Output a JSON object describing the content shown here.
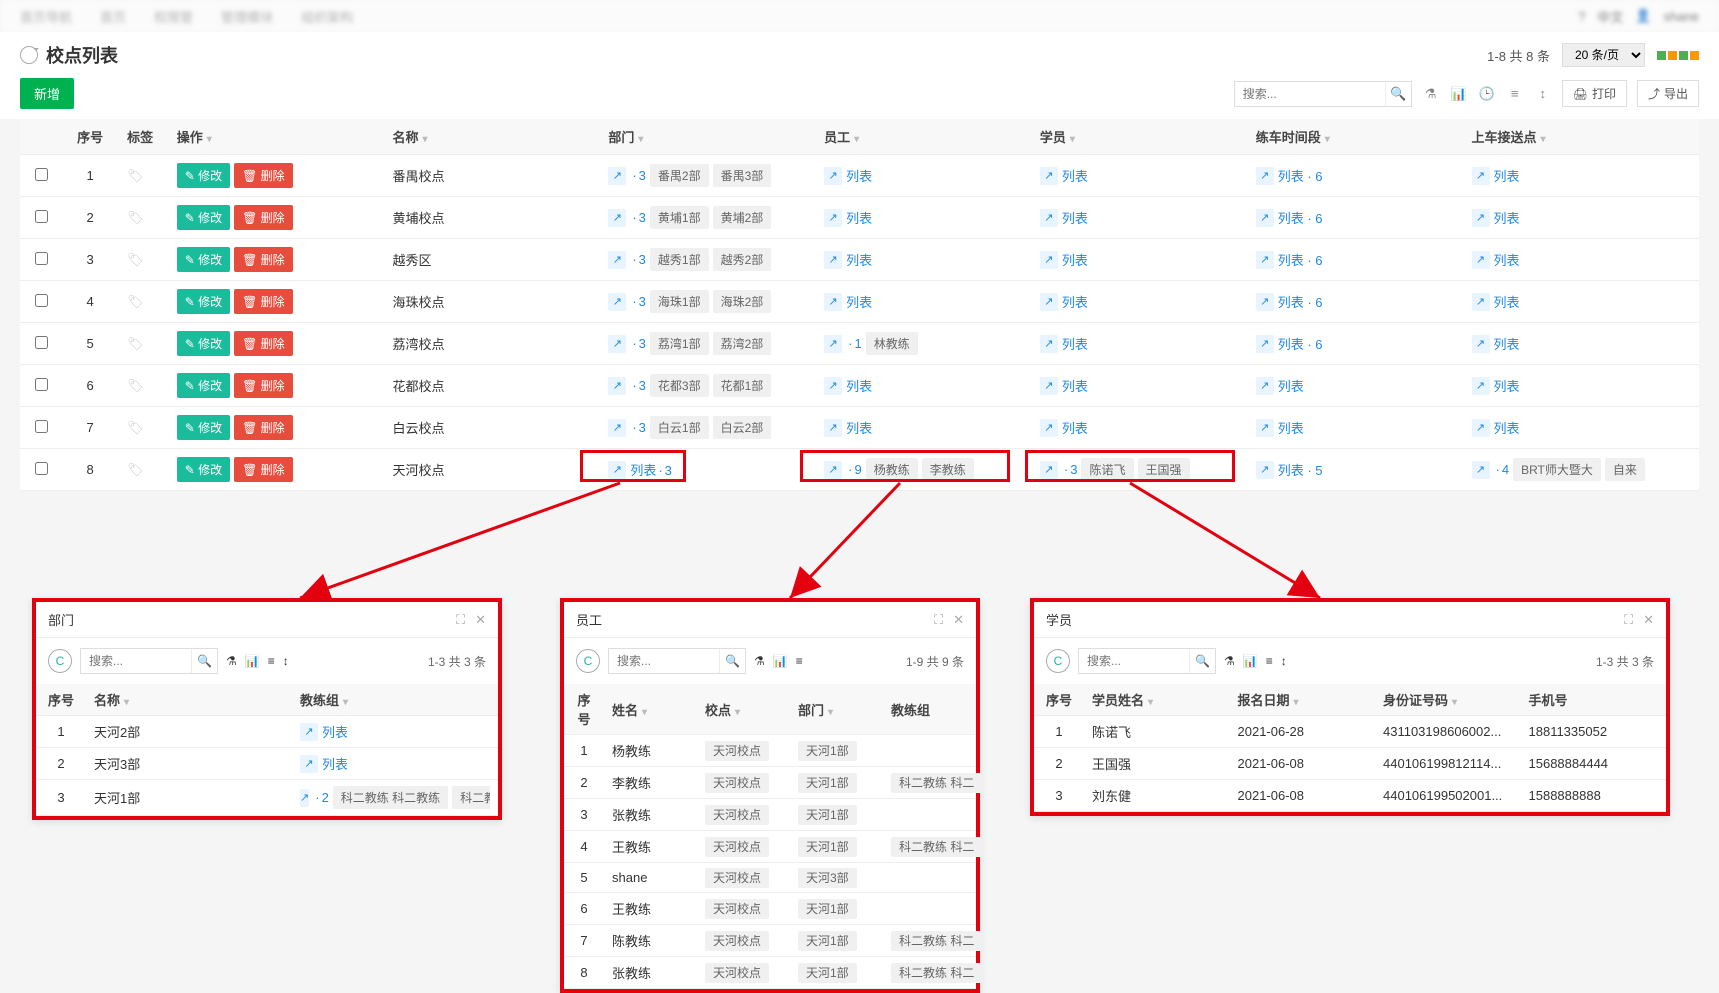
{
  "topnav": {
    "tabs": [
      "首页导航",
      "首页",
      "权限管",
      "管理模块",
      "组织架构"
    ],
    "lang": "中文",
    "user": "shane"
  },
  "page": {
    "title": "校点列表",
    "range": "1-8 共 8 条",
    "pageSize": "20 条/页",
    "search_ph": "搜索..."
  },
  "toolbar": {
    "add": "新增",
    "print_lbl": "打印",
    "export_lbl": "导出"
  },
  "columns": {
    "seq": "序号",
    "tag": "标签",
    "ops": "操作",
    "name": "名称",
    "dept": "部门",
    "emp": "员工",
    "stu": "学员",
    "time": "练车时间段",
    "pick": "上车接送点"
  },
  "ops": {
    "edit": "修改",
    "del": "删除",
    "list": "列表"
  },
  "rows": [
    {
      "seq": 1,
      "name": "番禺校点",
      "dept_n": 3,
      "dept_tags": [
        "番禺2部",
        "番禺3部"
      ],
      "emp": "list",
      "stu": "list",
      "time": "列表 · 6",
      "pick": "list"
    },
    {
      "seq": 2,
      "name": "黄埔校点",
      "dept_n": 3,
      "dept_tags": [
        "黄埔1部",
        "黄埔2部"
      ],
      "emp": "list",
      "stu": "list",
      "time": "列表 · 6",
      "pick": "list"
    },
    {
      "seq": 3,
      "name": "越秀区",
      "dept_n": 3,
      "dept_tags": [
        "越秀1部",
        "越秀2部"
      ],
      "emp": "list",
      "stu": "list",
      "time": "列表 · 6",
      "pick": "list"
    },
    {
      "seq": 4,
      "name": "海珠校点",
      "dept_n": 3,
      "dept_tags": [
        "海珠1部",
        "海珠2部"
      ],
      "emp": "list",
      "stu": "list",
      "time": "列表 · 6",
      "pick": "list"
    },
    {
      "seq": 5,
      "name": "荔湾校点",
      "dept_n": 3,
      "dept_tags": [
        "荔湾1部",
        "荔湾2部"
      ],
      "emp_n": 1,
      "emp_tags": [
        "林教练"
      ],
      "stu": "list",
      "time": "列表 · 6",
      "pick": "list"
    },
    {
      "seq": 6,
      "name": "花都校点",
      "dept_n": 3,
      "dept_tags": [
        "花都3部",
        "花都1部"
      ],
      "emp": "list",
      "stu": "list",
      "time": "list",
      "pick": "list"
    },
    {
      "seq": 7,
      "name": "白云校点",
      "dept_n": 3,
      "dept_tags": [
        "白云1部",
        "白云2部"
      ],
      "emp": "list",
      "stu": "list",
      "time": "list",
      "pick": "list"
    },
    {
      "seq": 8,
      "name": "天河校点",
      "dept_mode": "listnum",
      "dept_n": 3,
      "emp_n": 9,
      "emp_tags": [
        "杨教练",
        "李教练"
      ],
      "stu_n": 3,
      "stu_tags": [
        "陈诺飞",
        "王国强"
      ],
      "time": "列表 · 5",
      "pick_n": 4,
      "pick_tags": [
        "BRT师大暨大",
        "自来"
      ]
    }
  ],
  "popup_dept": {
    "title": "部门",
    "range": "1-3 共 3 条",
    "search_ph": "搜索...",
    "cols": [
      "序号",
      "名称",
      "教练组"
    ],
    "rows": [
      {
        "seq": 1,
        "name": "天河2部",
        "grp": "list"
      },
      {
        "seq": 2,
        "name": "天河3部",
        "grp": "list"
      },
      {
        "seq": 3,
        "name": "天河1部",
        "grp_n": 2,
        "grp_tags": [
          "科二教练 科二教练",
          "科二教练"
        ]
      }
    ]
  },
  "popup_emp": {
    "title": "员工",
    "range": "1-9 共 9 条",
    "search_ph": "搜索...",
    "cols": [
      "序号",
      "姓名",
      "校点",
      "部门",
      "教练组"
    ],
    "rows": [
      {
        "seq": 1,
        "name": "杨教练",
        "school": "天河校点",
        "dept": "天河1部",
        "grp": ""
      },
      {
        "seq": 2,
        "name": "李教练",
        "school": "天河校点",
        "dept": "天河1部",
        "grp": "科二教练 科二"
      },
      {
        "seq": 3,
        "name": "张教练",
        "school": "天河校点",
        "dept": "天河1部",
        "grp": ""
      },
      {
        "seq": 4,
        "name": "王教练",
        "school": "天河校点",
        "dept": "天河1部",
        "grp": "科二教练 科二"
      },
      {
        "seq": 5,
        "name": "shane",
        "school": "天河校点",
        "dept": "天河3部",
        "grp": ""
      },
      {
        "seq": 6,
        "name": "王教练",
        "school": "天河校点",
        "dept": "天河1部",
        "grp": ""
      },
      {
        "seq": 7,
        "name": "陈教练",
        "school": "天河校点",
        "dept": "天河1部",
        "grp": "科二教练 科二"
      },
      {
        "seq": 8,
        "name": "张教练",
        "school": "天河校点",
        "dept": "天河1部",
        "grp": "科二教练 科二"
      }
    ]
  },
  "popup_stu": {
    "title": "学员",
    "range": "1-3 共 3 条",
    "search_ph": "搜索...",
    "cols": [
      "序号",
      "学员姓名",
      "报名日期",
      "身份证号码",
      "手机号"
    ],
    "rows": [
      {
        "seq": 1,
        "name": "陈诺飞",
        "date": "2021-06-28",
        "id": "431103198606002...",
        "phone": "18811335052"
      },
      {
        "seq": 2,
        "name": "王国强",
        "date": "2021-06-08",
        "id": "440106199812114...",
        "phone": "15688884444"
      },
      {
        "seq": 3,
        "name": "刘东健",
        "date": "2021-06-08",
        "id": "440106199502001...",
        "phone": "1588888888"
      }
    ]
  }
}
